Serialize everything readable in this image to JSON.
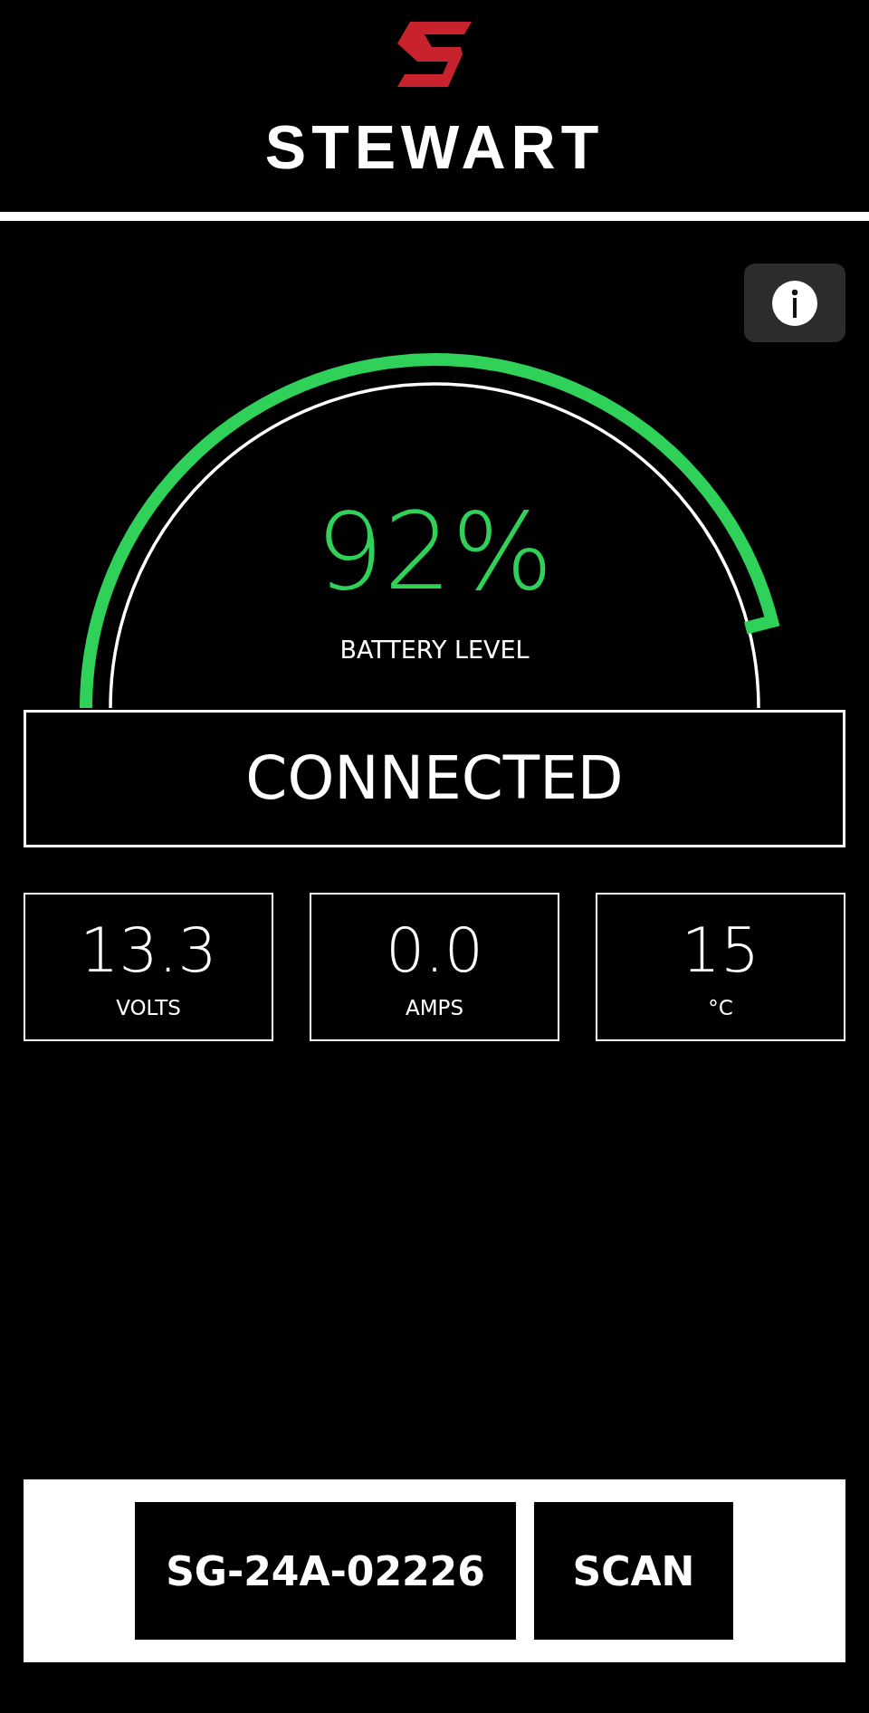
{
  "header": {
    "brand": "STEWART"
  },
  "gauge": {
    "reading": "92%",
    "label": "BATTERY LEVEL"
  },
  "status": {
    "text": "CONNECTED"
  },
  "stats": [
    {
      "value": "13.3",
      "unit": "VOLTS"
    },
    {
      "value": "0.0",
      "unit": "AMPS"
    },
    {
      "value": "15",
      "unit": "°C"
    }
  ],
  "footer": {
    "buttons": [
      {
        "label": "SG-24A-02226"
      },
      {
        "label": "SCAN"
      }
    ]
  }
}
